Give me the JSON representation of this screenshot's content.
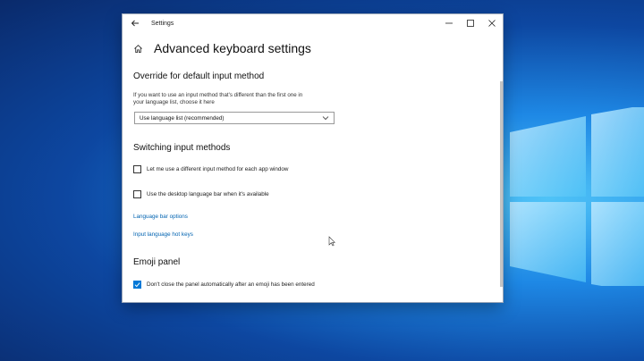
{
  "window": {
    "title": "Settings"
  },
  "page": {
    "title": "Advanced keyboard settings"
  },
  "override": {
    "heading": "Override for default input method",
    "description_line1": "If you want to use an input method that's different than the first one in",
    "description_line2": "your language list, choose it here",
    "dropdown_value": "Use language list (recommended)"
  },
  "switching": {
    "heading": "Switching input methods",
    "option1": {
      "label": "Let me use a different input method for each app window",
      "checked": false
    },
    "option2": {
      "label": "Use the desktop language bar when it's available",
      "checked": false
    },
    "link1": "Language bar options",
    "link2": "Input language hot keys"
  },
  "emoji": {
    "heading": "Emoji panel",
    "option": {
      "label": "Don't close the panel automatically after an emoji has been entered",
      "checked": true
    }
  },
  "colors": {
    "accent": "#0078d7",
    "link": "#0063b1"
  }
}
